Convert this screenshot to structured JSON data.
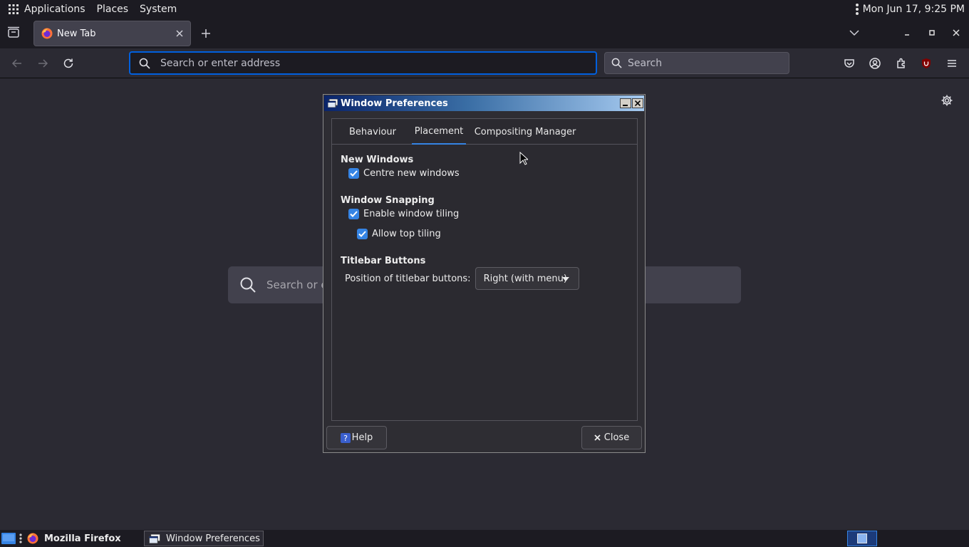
{
  "top_panel": {
    "menus": [
      "Applications",
      "Places",
      "System"
    ],
    "clock": "Mon Jun 17,  9:25 PM"
  },
  "browser": {
    "tab_title": "New Tab",
    "url_placeholder": "Search or enter address",
    "search_placeholder": "Search",
    "page_search_placeholder": "Search or e"
  },
  "dialog": {
    "title": "Window Preferences",
    "tabs": [
      "Behaviour",
      "Placement",
      "Compositing Manager"
    ],
    "active_tab": "Placement",
    "sections": {
      "new_windows": {
        "title": "New Windows",
        "centre_label": "Centre new windows",
        "centre_checked": true
      },
      "snapping": {
        "title": "Window Snapping",
        "tiling_label": "Enable window tiling",
        "tiling_checked": true,
        "top_label": "Allow top tiling",
        "top_checked": true
      },
      "titlebar": {
        "title": "Titlebar Buttons",
        "position_label": "Position of titlebar buttons:",
        "position_value": "Right (with menu)"
      }
    },
    "help_label": "Help",
    "close_label": "Close"
  },
  "bottom_panel": {
    "launcher_label": "Mozilla Firefox",
    "task_label": "Window Preferences"
  },
  "colors": {
    "accent": "#3584e4",
    "url_focus": "#0060df",
    "background": "#2b2a33"
  }
}
